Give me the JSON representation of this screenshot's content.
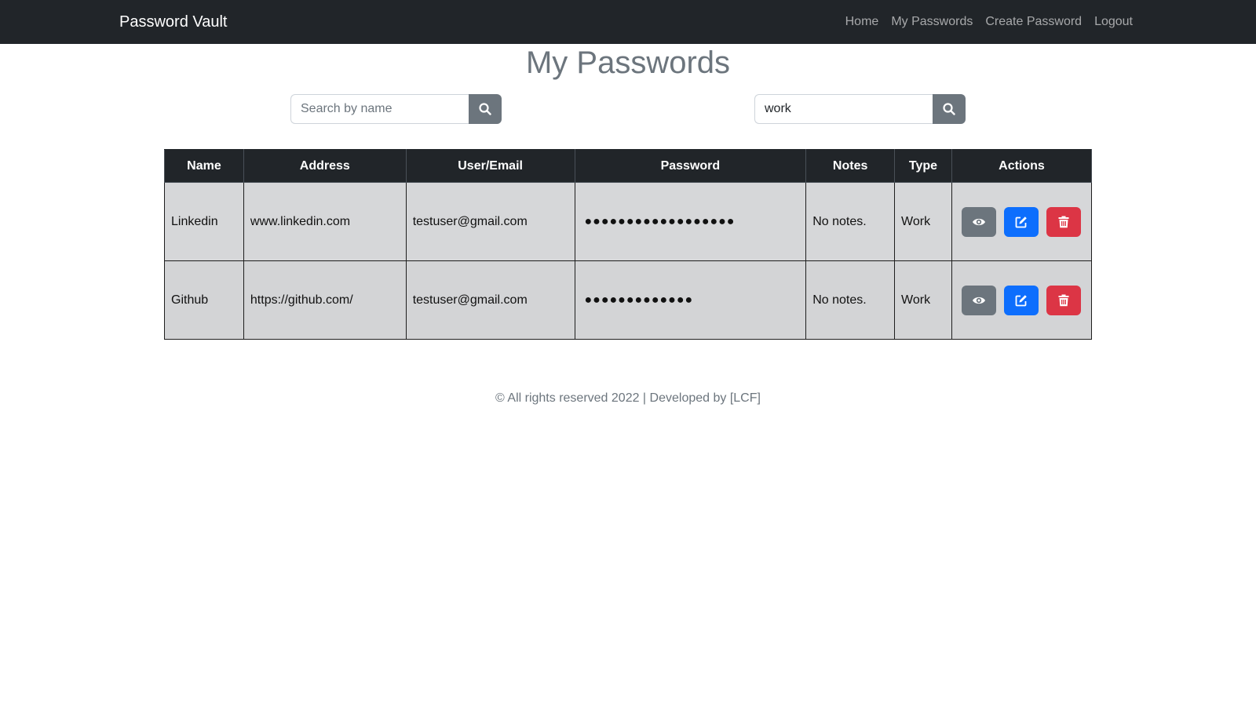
{
  "navbar": {
    "brand": "Password Vault",
    "links": [
      "Home",
      "My Passwords",
      "Create Password",
      "Logout"
    ]
  },
  "page": {
    "title": "My Passwords"
  },
  "search": {
    "name_placeholder": "Search by name",
    "name_value": "",
    "type_value": "work",
    "icon": "search-icon"
  },
  "table": {
    "headers": [
      "Name",
      "Address",
      "User/Email",
      "Password",
      "Notes",
      "Type",
      "Actions"
    ],
    "rows": [
      {
        "name": "Linkedin",
        "address": "www.linkedin.com",
        "user": "testuser@gmail.com",
        "password": "●●●●●●●●●●●●●●●●●●",
        "notes": "No notes.",
        "type": "Work"
      },
      {
        "name": "Github",
        "address": "https://github.com/",
        "user": "testuser@gmail.com",
        "password": "●●●●●●●●●●●●●",
        "notes": "No notes.",
        "type": "Work"
      }
    ],
    "action_icons": [
      "eye-icon",
      "edit-icon",
      "trash-icon"
    ]
  },
  "footer": {
    "text": "© All rights reserved 2022 | Developed by [LCF]"
  },
  "colors": {
    "navbar": "#212529",
    "secondary": "#6c757d",
    "primary": "#0d6efd",
    "danger": "#dc3545",
    "row_bg": "#d6d7d9"
  }
}
